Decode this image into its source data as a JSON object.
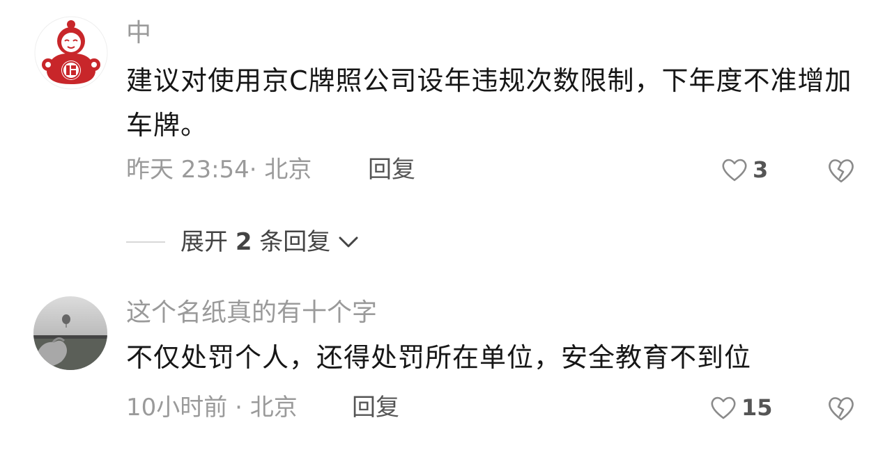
{
  "comments": [
    {
      "username": "中",
      "content": "建议对使用京C牌照公司设年违规次数限制，下年度不准增加车牌。",
      "time": "昨天 23:54",
      "location_sep": "·",
      "location": "北京",
      "reply_label": "回复",
      "likes": "3",
      "avatar_icon": "fortune-doll-icon"
    },
    {
      "username": "这个名纸真的有十个字",
      "content": "不仅处罚个人，还得处罚所在单位，安全教育不到位",
      "time": "10小时前",
      "location_sep": "·",
      "location": "北京",
      "reply_label": "回复",
      "likes": "15",
      "avatar_icon": "thumb-photo-icon"
    }
  ],
  "expand_replies": {
    "prefix": "展开",
    "count": "2",
    "suffix": "条回复",
    "icon": "chevron-down-icon"
  },
  "colors": {
    "accent_red": "#c8262a",
    "secondary_text": "#9a9a9a",
    "primary_text": "#161616"
  }
}
